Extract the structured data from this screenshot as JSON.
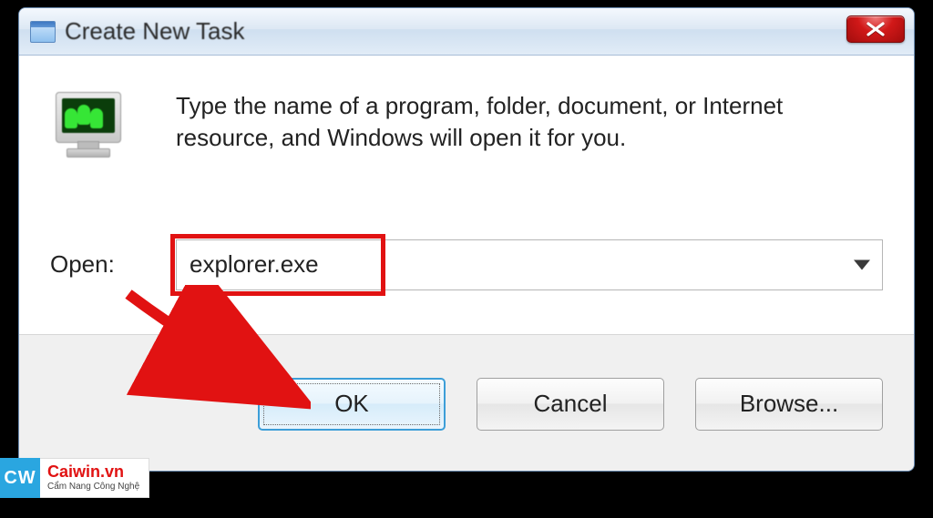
{
  "dialog": {
    "title": "Create New Task",
    "instruction": "Type the name of a program, folder, document, or Internet resource, and Windows will open it for you.",
    "open_label": "Open:",
    "input_value": "explorer.exe"
  },
  "buttons": {
    "ok": "OK",
    "cancel": "Cancel",
    "browse": "Browse..."
  },
  "watermark": {
    "logo": "CW",
    "site": "Caiwin.vn",
    "tagline": "Cẩm Nang Công Nghệ"
  }
}
